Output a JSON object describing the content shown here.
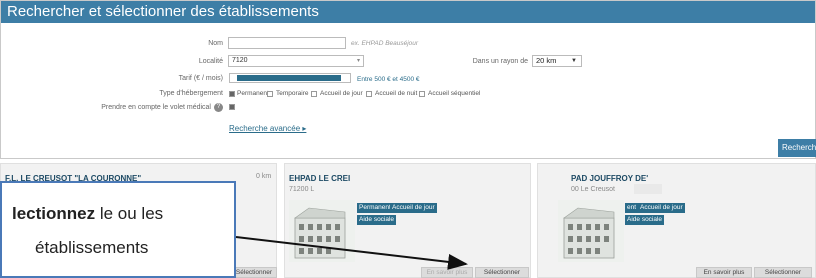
{
  "panel": {
    "title": "Rechercher et sélectionner des établissements",
    "nom": {
      "label": "Nom",
      "value": "",
      "hint": "ex. EHPAD Beauséjour"
    },
    "localite": {
      "label": "Localité",
      "value": "7120"
    },
    "rayon": {
      "label": "Dans un rayon de",
      "value": "20 km"
    },
    "tarif": {
      "label": "Tarif (€ / mois)",
      "range_text": "Entre 500 € et 4500 €",
      "range_min": 500,
      "range_max": 4500
    },
    "hebergement": {
      "label": "Type d'hébergement",
      "options": [
        {
          "label": "Permanent",
          "checked": true
        },
        {
          "label": "Temporaire",
          "checked": false
        },
        {
          "label": "Accueil de jour",
          "checked": false
        },
        {
          "label": "Accueil de nuit",
          "checked": false
        },
        {
          "label": "Accueil séquentiel",
          "checked": false
        }
      ]
    },
    "medical": {
      "label": "Prendre en compte le volet médical",
      "help_icon": "?",
      "checked": true
    },
    "advanced_link": "Recherche avancée ▸",
    "search_button": "Rechercher"
  },
  "cards": [
    {
      "title": "F.L. LE CREUSOT \"LA COURONNE\"",
      "distance": "0 km",
      "select_label": "Sélectionner"
    },
    {
      "title": "EHPAD LE CREI",
      "location": "71200 L",
      "tags": [
        "Permanent",
        "Accueil de jour",
        "Aide sociale"
      ],
      "info_label": "En savoir plus",
      "select_label": "Sélectionner"
    },
    {
      "title": "PAD JOUFFROY DE'",
      "location": "00 Le Creusot",
      "tags": [
        "ent",
        "Accueil de jour",
        "Aide sociale"
      ],
      "info_label": "En savoir plus",
      "select_label": "Sélectionner"
    }
  ],
  "callout": {
    "bold_text": "lectionnez",
    "rest_line1": " le ou les",
    "line2": "établissements"
  }
}
